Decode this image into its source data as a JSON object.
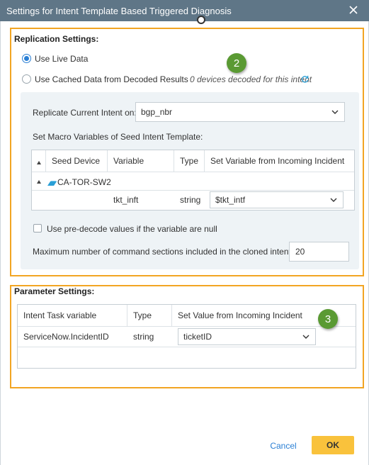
{
  "dialog": {
    "title": "Settings for Intent Template Based Triggered Diagnosis"
  },
  "replication": {
    "title": "Replication Settings:",
    "radio_live": "Use Live Data",
    "radio_cached": "Use Cached Data from Decoded Results",
    "devices_status": "0 devices decoded for this intent",
    "badge": "2",
    "replicate_label": "Replicate Current Intent on:",
    "replicate_value": "bgp_nbr",
    "macro_label": "Set Macro Variables of Seed Intent Template:",
    "table": {
      "headers": [
        "Seed Device",
        "Variable",
        "Type",
        "Set Variable from Incoming Incident"
      ],
      "device": "CA-TOR-SW2",
      "row": {
        "variable": "tkt_inft",
        "type": "string",
        "value": "$tkt_intf"
      }
    },
    "predecode_label": "Use pre-decode values if the variable are null",
    "max_sections_label": "Maximum number of command sections included in the cloned intent:",
    "max_sections_value": "20"
  },
  "parameter": {
    "title": "Parameter Settings:",
    "badge": "3",
    "table": {
      "headers": [
        "Intent Task variable",
        "Type",
        "Set Value from Incoming Incident"
      ],
      "row": {
        "variable": "ServiceNow.IncidentID",
        "type": "string",
        "value": "ticketID"
      }
    }
  },
  "footer": {
    "cancel": "Cancel",
    "ok": "OK"
  },
  "colors": {
    "titlebar": "#5f7687",
    "highlight_border": "#f2a523",
    "badge": "#5a9a33",
    "ok_button": "#f9c23c",
    "link": "#2a7fd4"
  }
}
